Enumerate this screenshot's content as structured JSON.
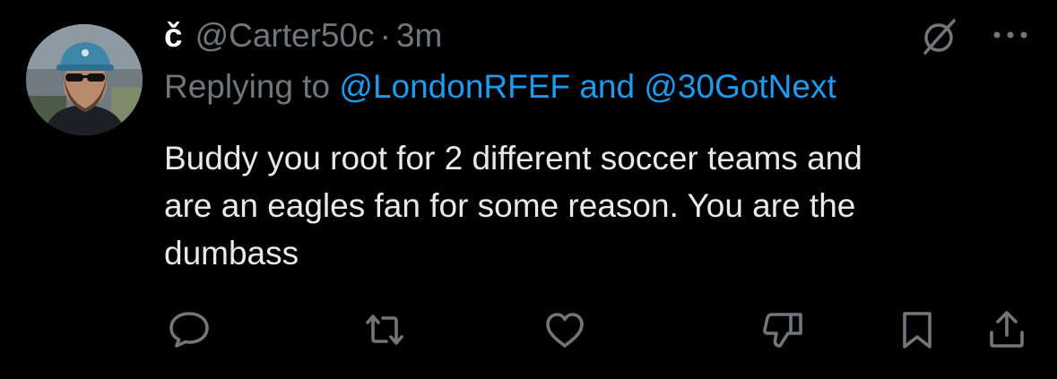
{
  "tweet": {
    "display_name": "č",
    "handle": "@Carter50c",
    "separator": "·",
    "time": "3m",
    "replying_prefix": "Replying to",
    "mention_1": "@LondonRFEF",
    "replying_and": "and",
    "mention_2": "@30GotNext",
    "body_lines": [
      "Buddy you root for 2 different soccer teams and",
      "are an eagles fan for some reason. You are the",
      "dumbass"
    ]
  },
  "icons": {
    "header": [
      "grok-icon",
      "more-icon"
    ],
    "actions": [
      "reply-icon",
      "retweet-icon",
      "like-icon",
      "dislike-icon",
      "bookmark-icon",
      "share-icon"
    ]
  },
  "colors": {
    "background": "#000000",
    "text": "#e7e9ea",
    "secondary": "#71767b",
    "link": "#1d9bf0"
  }
}
